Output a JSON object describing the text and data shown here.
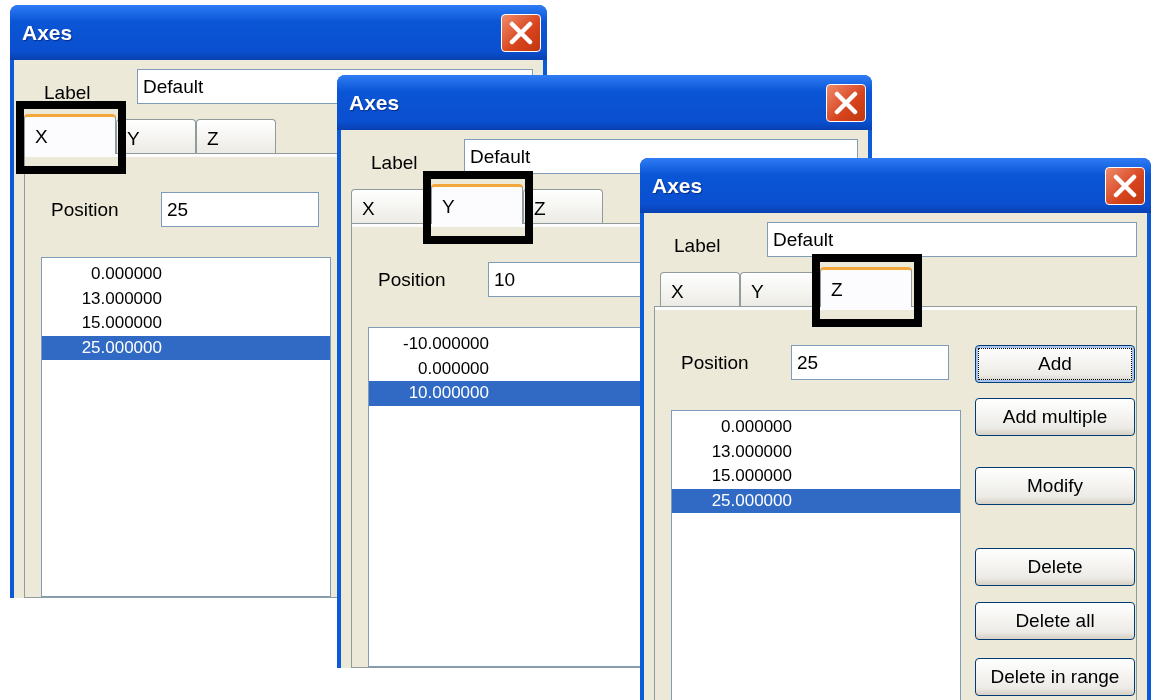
{
  "windows": [
    {
      "title": "Axes",
      "label_text": "Label",
      "label_value": "Default",
      "tabs": [
        {
          "label": "X",
          "selected": true
        },
        {
          "label": "Y",
          "selected": false
        },
        {
          "label": "Z",
          "selected": false
        }
      ],
      "position_label": "Position",
      "position_value": "25",
      "items": [
        {
          "text": "0.000000",
          "selected": false
        },
        {
          "text": "13.000000",
          "selected": false
        },
        {
          "text": "15.000000",
          "selected": false
        },
        {
          "text": "25.000000",
          "selected": true
        }
      ]
    },
    {
      "title": "Axes",
      "label_text": "Label",
      "label_value": "Default",
      "tabs": [
        {
          "label": "X",
          "selected": false
        },
        {
          "label": "Y",
          "selected": true
        },
        {
          "label": "Z",
          "selected": false
        }
      ],
      "position_label": "Position",
      "position_value": "10",
      "items": [
        {
          "text": "-10.000000",
          "selected": false
        },
        {
          "text": "0.000000",
          "selected": false
        },
        {
          "text": "10.000000",
          "selected": true
        }
      ]
    },
    {
      "title": "Axes",
      "label_text": "Label",
      "label_value": "Default",
      "tabs": [
        {
          "label": "X",
          "selected": false
        },
        {
          "label": "Y",
          "selected": false
        },
        {
          "label": "Z",
          "selected": true
        }
      ],
      "position_label": "Position",
      "position_value": "25",
      "items": [
        {
          "text": "0.000000",
          "selected": false
        },
        {
          "text": "13.000000",
          "selected": false
        },
        {
          "text": "15.000000",
          "selected": false
        },
        {
          "text": "25.000000",
          "selected": true
        }
      ],
      "buttons": [
        {
          "label": "Add",
          "focused": true
        },
        {
          "label": "Add multiple",
          "focused": false
        },
        {
          "label": "Modify",
          "focused": false
        },
        {
          "label": "Delete",
          "focused": false
        },
        {
          "label": "Delete all",
          "focused": false
        },
        {
          "label": "Delete in range",
          "focused": false
        }
      ]
    }
  ]
}
